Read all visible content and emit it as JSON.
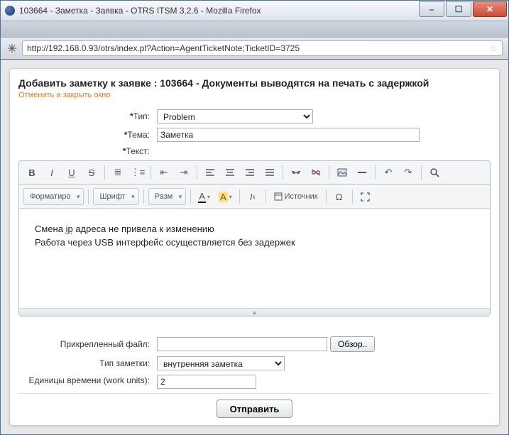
{
  "window": {
    "title": "103664 - Заметка - Заявка - OTRS ITSM 3.2.6 - Mozilla Firefox",
    "url": "http://192.168.0.93/otrs/index.pl?Action=AgentTicketNote;TicketID=3725"
  },
  "page": {
    "heading": "Добавить заметку к заявке : 103664 - Документы выводятся на печать с задержкой",
    "cancel_link": "Отменить и закрыть окно"
  },
  "labels": {
    "type": "Тип:",
    "subject": "Тема:",
    "text": "Текст:",
    "attachment": "Прикрепленный файл:",
    "note_type": "Тип заметки:",
    "time_units": "Единицы времени (work units):",
    "required_mark": "*"
  },
  "values": {
    "type": "Problem",
    "subject": "Заметка",
    "body_line1": "Смена ip адреса не привела к изменению",
    "body_line2": "Работа через USB интерфейс осуществляется без задержек",
    "attachment": "",
    "note_type": "внутренняя заметка",
    "time_units": "2"
  },
  "buttons": {
    "browse": "Обзор..",
    "submit": "Отправить"
  },
  "editor_toolbar": {
    "format": "Форматиро",
    "font": "Шрифт",
    "size": "Разм",
    "source": "Источник"
  }
}
